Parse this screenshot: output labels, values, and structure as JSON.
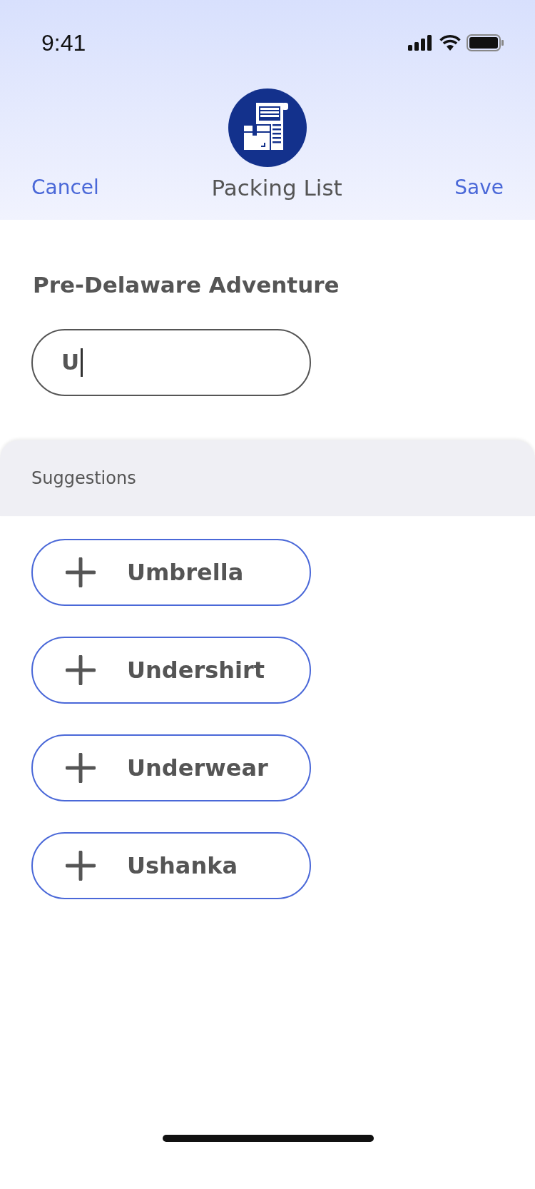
{
  "status_bar": {
    "time": "9:41"
  },
  "header": {
    "title": "Packing List",
    "cancel": "Cancel",
    "save": "Save"
  },
  "list_name": "Pre-Delaware Adventure",
  "search": {
    "value": "U"
  },
  "suggestions": {
    "heading": "Suggestions",
    "items": [
      {
        "label": "Umbrella"
      },
      {
        "label": "Undershirt"
      },
      {
        "label": "Underwear"
      },
      {
        "label": "Ushanka"
      }
    ]
  }
}
